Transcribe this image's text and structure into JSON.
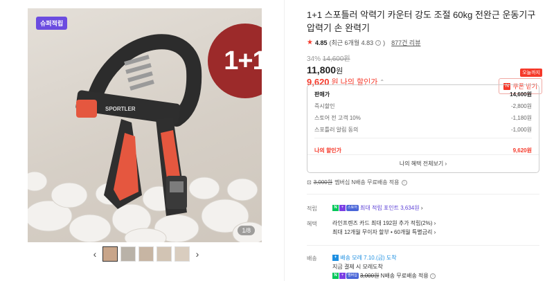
{
  "gallery": {
    "tag": "슈퍼적립",
    "promo": "1+1",
    "counter": "1/8",
    "thumb_count": 5,
    "prev_icon": "chevron-left-icon",
    "next_icon": "chevron-right-icon",
    "brand_on_product": "SPORTLER"
  },
  "product": {
    "title": "1+1 스포틀러 악력기 카운터 강도 조절 60kg 전완근 운동기구 압력기 손 완력기",
    "rating_score": "4.85",
    "rating_detail": "(최근 6개월 4.83",
    "reviews": "877건 리뷰",
    "discount_pct": "34%",
    "original_price": "14,600원",
    "price": "11,800",
    "price_unit": "원",
    "my_price": "9,620",
    "my_price_unit": "원",
    "my_price_label": "나의 할인가"
  },
  "coupon": {
    "today": "오늘까지",
    "button": "쿠폰 받기"
  },
  "breakdown": {
    "rows": [
      {
        "label": "판매가",
        "value": "14,600원"
      },
      {
        "label": "즉시할인",
        "value": "-2,800원"
      },
      {
        "label": "스토어 전 고객 10%",
        "value": "-1,180원"
      },
      {
        "label": "스포틀러 알림 동의",
        "value": "-1,000원"
      }
    ],
    "mine_label": "나의 할인가",
    "mine_value": "9,620원",
    "all_benefits": "나의 혜택 전체보기"
  },
  "shipping_note": {
    "fee": "3,000원",
    "text": "멤버십 N배송 무료배송 적용"
  },
  "points": {
    "label": "적립",
    "text": "최대 적립 포인트 3,634원"
  },
  "benefits": {
    "label": "혜택",
    "line1": "라인프렌즈 카드 최대 192원 추가 적립(2%)",
    "line2": "최대 12개월 무이자 할부 • 60개월 특별금리"
  },
  "delivery": {
    "label": "배송",
    "badge": "배송",
    "arrival": "모레 7.10.(금) 도착",
    "payment": "지금 결제 시 모레도착",
    "fee": "3,000원",
    "free_text": "N배송 무료배송 적용"
  },
  "colors": {
    "accent_red": "#f5392a",
    "promo_maroon": "#9c2a2a",
    "tag_purple": "#6b4ce0",
    "npay_green": "#03c75a"
  }
}
